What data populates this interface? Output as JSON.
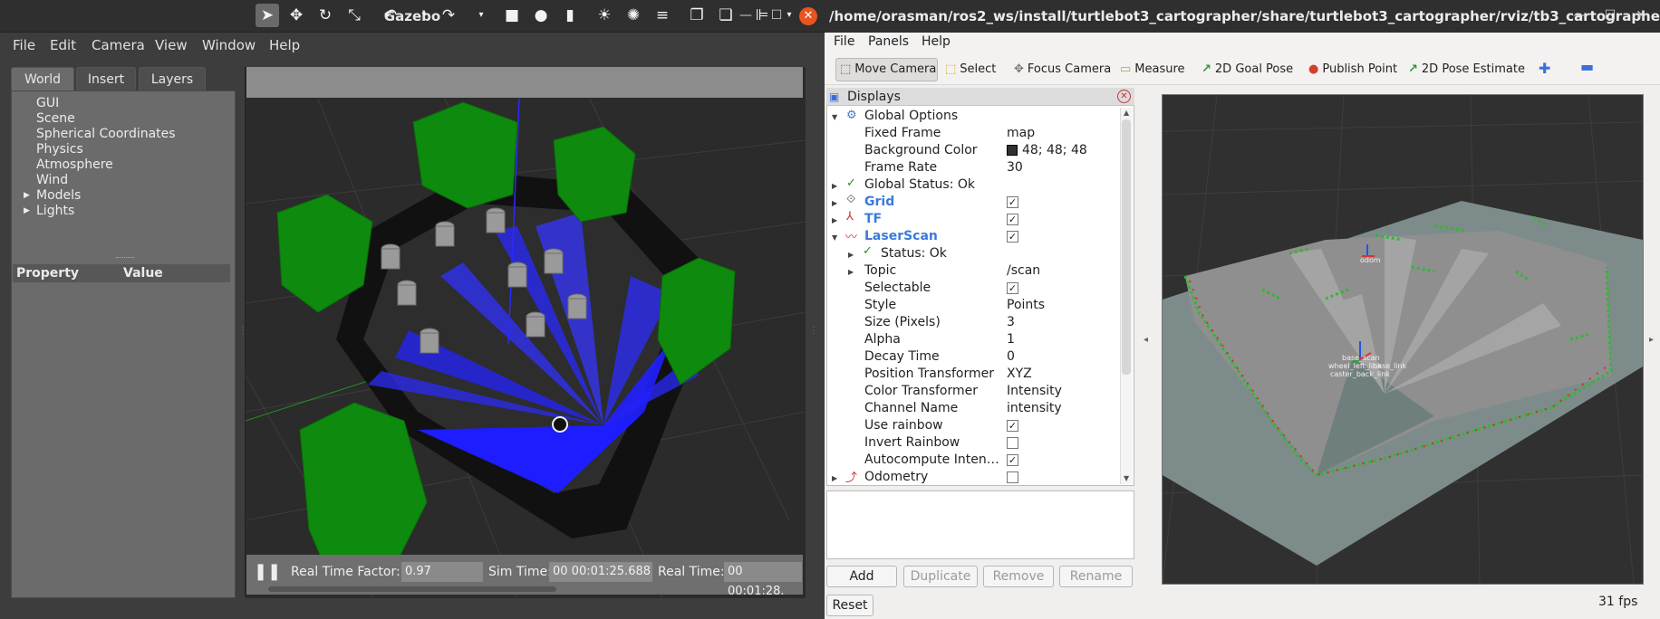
{
  "gazebo": {
    "title": "Gazebo",
    "menu": [
      "File",
      "Edit",
      "Camera",
      "View",
      "Window",
      "Help"
    ],
    "tabs": [
      "World",
      "Insert",
      "Layers"
    ],
    "tree": [
      "GUI",
      "Scene",
      "Spherical Coordinates",
      "Physics",
      "Atmosphere",
      "Wind",
      "Models",
      "Lights"
    ],
    "property_header": "Property",
    "value_header": "Value",
    "bottom": {
      "rtf_label": "Real Time Factor:",
      "rtf_value": "0.97",
      "sim_label": "Sim Time:",
      "sim_value": "00 00:01:25.688",
      "real_label": "Real Time:",
      "real_value": "00 00:01:28."
    }
  },
  "rviz": {
    "title": "/home/orasman/ros2_ws/install/turtlebot3_cartographer/share/turtlebot3_cartographer/rviz/tb3_cartographer.r...",
    "menu": [
      "File",
      "Panels",
      "Help"
    ],
    "tools": [
      "Move Camera",
      "Select",
      "Focus Camera",
      "Measure",
      "2D Goal Pose",
      "Publish Point",
      "2D Pose Estimate"
    ],
    "displays_title": "Displays",
    "rows": {
      "global_options": "Global Options",
      "fixed_frame": "Fixed Frame",
      "fixed_frame_val": "map",
      "bg_color": "Background Color",
      "bg_color_val": "48; 48; 48",
      "frame_rate": "Frame Rate",
      "frame_rate_val": "30",
      "global_status": "Global Status: Ok",
      "grid": "Grid",
      "tf": "TF",
      "laserscan": "LaserScan",
      "status": "Status: Ok",
      "topic": "Topic",
      "topic_val": "/scan",
      "selectable": "Selectable",
      "style": "Style",
      "style_val": "Points",
      "size": "Size (Pixels)",
      "size_val": "3",
      "alpha": "Alpha",
      "alpha_val": "1",
      "decay": "Decay Time",
      "decay_val": "0",
      "pos_tf": "Position Transformer",
      "pos_tf_val": "XYZ",
      "color_tf": "Color Transformer",
      "color_tf_val": "Intensity",
      "channel": "Channel Name",
      "channel_val": "intensity",
      "use_rainbow": "Use rainbow",
      "invert_rainbow": "Invert Rainbow",
      "autocompute": "Autocompute Inten…",
      "odometry": "Odometry"
    },
    "buttons": {
      "add": "Add",
      "duplicate": "Duplicate",
      "remove": "Remove",
      "rename": "Rename",
      "reset": "Reset"
    },
    "fps": "31 fps",
    "viewport_labels": [
      "odom",
      "base_scan",
      "wheel_left_link",
      "base_link",
      "caster_back_link"
    ]
  }
}
